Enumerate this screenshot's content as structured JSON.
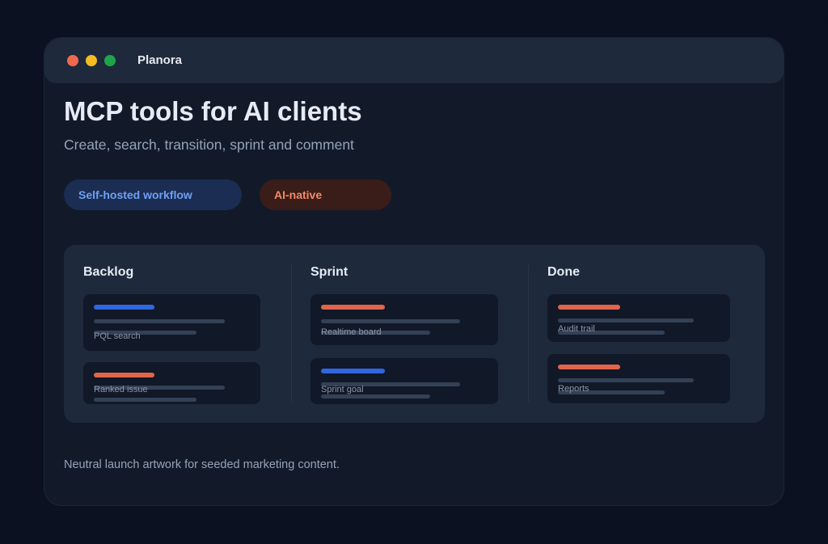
{
  "app": {
    "title": "Planora"
  },
  "window_controls": {
    "close_color": "#ee6a4c",
    "minimize_color": "#f5bb22",
    "zoom_color": "#1ea54a"
  },
  "hero": {
    "title": "MCP tools for AI clients",
    "subtitle": "Create, search, transition, sprint and comment"
  },
  "badges": [
    {
      "label": "Self-hosted workflow",
      "color": "#6fa0f4"
    },
    {
      "label": "AI-native",
      "color": "#f28a66"
    }
  ],
  "board": {
    "columns": [
      {
        "title": "Backlog",
        "cards": [
          {
            "label": "PQL search",
            "accent": "blue"
          },
          {
            "label": "Ranked issue",
            "accent": "orange"
          }
        ]
      },
      {
        "title": "Sprint",
        "cards": [
          {
            "label": "Realtime board",
            "accent": "orange"
          },
          {
            "label": "Sprint goal",
            "accent": "blue"
          }
        ]
      },
      {
        "title": "Done",
        "cards": [
          {
            "label": "Audit trail",
            "accent": "orange"
          },
          {
            "label": "Reports",
            "accent": "orange"
          }
        ]
      }
    ]
  },
  "footer": {
    "note": "Neutral launch artwork for seeded marketing content."
  }
}
